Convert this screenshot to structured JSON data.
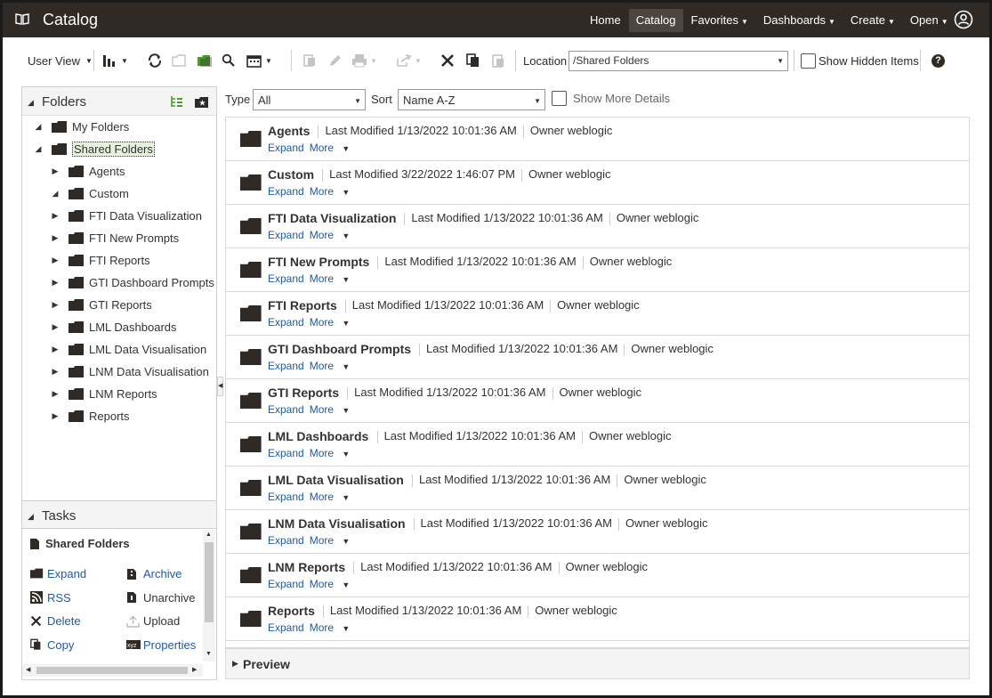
{
  "app": {
    "title": "Catalog"
  },
  "nav": {
    "items": [
      {
        "label": "Home",
        "has_menu": false
      },
      {
        "label": "Catalog",
        "has_menu": false,
        "active": true
      },
      {
        "label": "Favorites",
        "has_menu": true
      },
      {
        "label": "Dashboards",
        "has_menu": true
      },
      {
        "label": "Create",
        "has_menu": true
      },
      {
        "label": "Open",
        "has_menu": true
      }
    ]
  },
  "toolbar": {
    "user_view_label": "User View",
    "location_label": "Location",
    "location_value": "/Shared Folders",
    "show_hidden_label": "Show Hidden Items",
    "help_glyph": "?"
  },
  "folders_panel": {
    "title": "Folders",
    "tree": [
      {
        "label": "My Folders",
        "level": 0,
        "toggle": "expanded"
      },
      {
        "label": "Shared Folders",
        "level": 0,
        "toggle": "expanded",
        "selected": true
      },
      {
        "label": "Agents",
        "level": 1,
        "toggle": "collapsed"
      },
      {
        "label": "Custom",
        "level": 1,
        "toggle": "expanded"
      },
      {
        "label": "FTI Data Visualization",
        "level": 1,
        "toggle": "collapsed"
      },
      {
        "label": "FTI New Prompts",
        "level": 1,
        "toggle": "collapsed"
      },
      {
        "label": "FTI Reports",
        "level": 1,
        "toggle": "collapsed"
      },
      {
        "label": "GTI Dashboard Prompts",
        "level": 1,
        "toggle": "collapsed"
      },
      {
        "label": "GTI Reports",
        "level": 1,
        "toggle": "collapsed"
      },
      {
        "label": "LML Dashboards",
        "level": 1,
        "toggle": "collapsed"
      },
      {
        "label": "LML Data Visualisation",
        "level": 1,
        "toggle": "collapsed"
      },
      {
        "label": "LNM Data Visualisation",
        "level": 1,
        "toggle": "collapsed"
      },
      {
        "label": "LNM Reports",
        "level": 1,
        "toggle": "collapsed"
      },
      {
        "label": "Reports",
        "level": 1,
        "toggle": "collapsed"
      }
    ]
  },
  "tasks_panel": {
    "title": "Tasks",
    "context": "Shared Folders",
    "left": [
      {
        "label": "Expand",
        "icon": "folder-icon",
        "enabled": true
      },
      {
        "label": "RSS",
        "icon": "rss-icon",
        "enabled": true
      },
      {
        "label": "Delete",
        "icon": "delete-icon",
        "enabled": true
      },
      {
        "label": "Copy",
        "icon": "copy-icon",
        "enabled": true
      }
    ],
    "right": [
      {
        "label": "Archive",
        "icon": "archive-icon",
        "enabled": true
      },
      {
        "label": "Unarchive",
        "icon": "unarchive-icon",
        "enabled": false
      },
      {
        "label": "Upload",
        "icon": "upload-icon",
        "enabled": false
      },
      {
        "label": "Properties",
        "icon": "properties-icon",
        "enabled": true
      }
    ]
  },
  "filters": {
    "type_label": "Type",
    "type_value": "All",
    "sort_label": "Sort",
    "sort_value": "Name A-Z",
    "show_details_label": "Show More Details"
  },
  "list": {
    "last_modified_label": "Last Modified",
    "owner_label": "Owner",
    "expand_label": "Expand",
    "more_label": "More",
    "items": [
      {
        "name": "Agents",
        "modified": "1/13/2022 10:01:36 AM",
        "owner": "weblogic"
      },
      {
        "name": "Custom",
        "modified": "3/22/2022 1:46:07 PM",
        "owner": "weblogic"
      },
      {
        "name": "FTI Data Visualization",
        "modified": "1/13/2022 10:01:36 AM",
        "owner": "weblogic"
      },
      {
        "name": "FTI New Prompts",
        "modified": "1/13/2022 10:01:36 AM",
        "owner": "weblogic"
      },
      {
        "name": "FTI Reports",
        "modified": "1/13/2022 10:01:36 AM",
        "owner": "weblogic"
      },
      {
        "name": "GTI Dashboard Prompts",
        "modified": "1/13/2022 10:01:36 AM",
        "owner": "weblogic"
      },
      {
        "name": "GTI Reports",
        "modified": "1/13/2022 10:01:36 AM",
        "owner": "weblogic"
      },
      {
        "name": "LML Dashboards",
        "modified": "1/13/2022 10:01:36 AM",
        "owner": "weblogic"
      },
      {
        "name": "LML Data Visualisation",
        "modified": "1/13/2022 10:01:36 AM",
        "owner": "weblogic"
      },
      {
        "name": "LNM Data Visualisation",
        "modified": "1/13/2022 10:01:36 AM",
        "owner": "weblogic"
      },
      {
        "name": "LNM Reports",
        "modified": "1/13/2022 10:01:36 AM",
        "owner": "weblogic"
      },
      {
        "name": "Reports",
        "modified": "1/13/2022 10:01:36 AM",
        "owner": "weblogic"
      }
    ]
  },
  "preview": {
    "label": "Preview"
  },
  "colors": {
    "topbar": "#2f2a26",
    "link": "#1f5a9e",
    "accent_green": "#4e9a2a"
  }
}
